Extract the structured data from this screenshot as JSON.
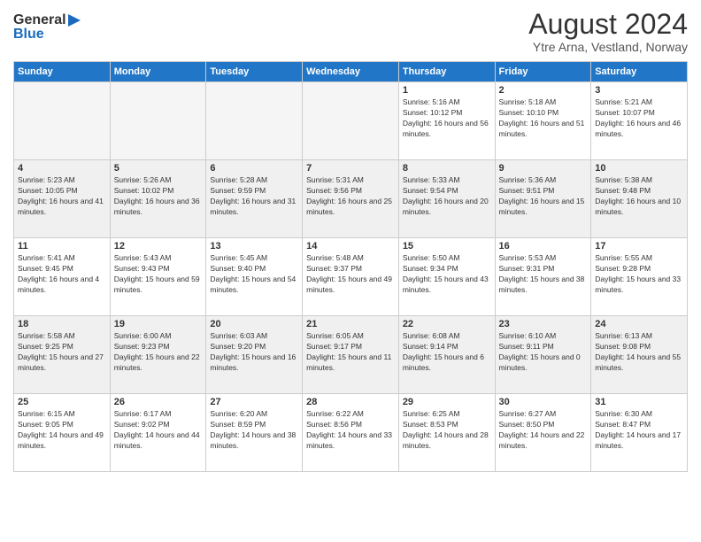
{
  "header": {
    "logo_general": "General",
    "logo_blue": "Blue",
    "month_year": "August 2024",
    "location": "Ytre Arna, Vestland, Norway"
  },
  "weekdays": [
    "Sunday",
    "Monday",
    "Tuesday",
    "Wednesday",
    "Thursday",
    "Friday",
    "Saturday"
  ],
  "weeks": [
    [
      {
        "day": "",
        "empty": true
      },
      {
        "day": "",
        "empty": true
      },
      {
        "day": "",
        "empty": true
      },
      {
        "day": "",
        "empty": true
      },
      {
        "day": "1",
        "sunrise": "5:16 AM",
        "sunset": "10:12 PM",
        "daylight": "16 hours and 56 minutes."
      },
      {
        "day": "2",
        "sunrise": "5:18 AM",
        "sunset": "10:10 PM",
        "daylight": "16 hours and 51 minutes."
      },
      {
        "day": "3",
        "sunrise": "5:21 AM",
        "sunset": "10:07 PM",
        "daylight": "16 hours and 46 minutes."
      }
    ],
    [
      {
        "day": "4",
        "sunrise": "5:23 AM",
        "sunset": "10:05 PM",
        "daylight": "16 hours and 41 minutes."
      },
      {
        "day": "5",
        "sunrise": "5:26 AM",
        "sunset": "10:02 PM",
        "daylight": "16 hours and 36 minutes."
      },
      {
        "day": "6",
        "sunrise": "5:28 AM",
        "sunset": "9:59 PM",
        "daylight": "16 hours and 31 minutes."
      },
      {
        "day": "7",
        "sunrise": "5:31 AM",
        "sunset": "9:56 PM",
        "daylight": "16 hours and 25 minutes."
      },
      {
        "day": "8",
        "sunrise": "5:33 AM",
        "sunset": "9:54 PM",
        "daylight": "16 hours and 20 minutes."
      },
      {
        "day": "9",
        "sunrise": "5:36 AM",
        "sunset": "9:51 PM",
        "daylight": "16 hours and 15 minutes."
      },
      {
        "day": "10",
        "sunrise": "5:38 AM",
        "sunset": "9:48 PM",
        "daylight": "16 hours and 10 minutes."
      }
    ],
    [
      {
        "day": "11",
        "sunrise": "5:41 AM",
        "sunset": "9:45 PM",
        "daylight": "16 hours and 4 minutes."
      },
      {
        "day": "12",
        "sunrise": "5:43 AM",
        "sunset": "9:43 PM",
        "daylight": "15 hours and 59 minutes."
      },
      {
        "day": "13",
        "sunrise": "5:45 AM",
        "sunset": "9:40 PM",
        "daylight": "15 hours and 54 minutes."
      },
      {
        "day": "14",
        "sunrise": "5:48 AM",
        "sunset": "9:37 PM",
        "daylight": "15 hours and 49 minutes."
      },
      {
        "day": "15",
        "sunrise": "5:50 AM",
        "sunset": "9:34 PM",
        "daylight": "15 hours and 43 minutes."
      },
      {
        "day": "16",
        "sunrise": "5:53 AM",
        "sunset": "9:31 PM",
        "daylight": "15 hours and 38 minutes."
      },
      {
        "day": "17",
        "sunrise": "5:55 AM",
        "sunset": "9:28 PM",
        "daylight": "15 hours and 33 minutes."
      }
    ],
    [
      {
        "day": "18",
        "sunrise": "5:58 AM",
        "sunset": "9:25 PM",
        "daylight": "15 hours and 27 minutes."
      },
      {
        "day": "19",
        "sunrise": "6:00 AM",
        "sunset": "9:23 PM",
        "daylight": "15 hours and 22 minutes."
      },
      {
        "day": "20",
        "sunrise": "6:03 AM",
        "sunset": "9:20 PM",
        "daylight": "15 hours and 16 minutes."
      },
      {
        "day": "21",
        "sunrise": "6:05 AM",
        "sunset": "9:17 PM",
        "daylight": "15 hours and 11 minutes."
      },
      {
        "day": "22",
        "sunrise": "6:08 AM",
        "sunset": "9:14 PM",
        "daylight": "15 hours and 6 minutes."
      },
      {
        "day": "23",
        "sunrise": "6:10 AM",
        "sunset": "9:11 PM",
        "daylight": "15 hours and 0 minutes."
      },
      {
        "day": "24",
        "sunrise": "6:13 AM",
        "sunset": "9:08 PM",
        "daylight": "14 hours and 55 minutes."
      }
    ],
    [
      {
        "day": "25",
        "sunrise": "6:15 AM",
        "sunset": "9:05 PM",
        "daylight": "14 hours and 49 minutes."
      },
      {
        "day": "26",
        "sunrise": "6:17 AM",
        "sunset": "9:02 PM",
        "daylight": "14 hours and 44 minutes."
      },
      {
        "day": "27",
        "sunrise": "6:20 AM",
        "sunset": "8:59 PM",
        "daylight": "14 hours and 38 minutes."
      },
      {
        "day": "28",
        "sunrise": "6:22 AM",
        "sunset": "8:56 PM",
        "daylight": "14 hours and 33 minutes."
      },
      {
        "day": "29",
        "sunrise": "6:25 AM",
        "sunset": "8:53 PM",
        "daylight": "14 hours and 28 minutes."
      },
      {
        "day": "30",
        "sunrise": "6:27 AM",
        "sunset": "8:50 PM",
        "daylight": "14 hours and 22 minutes."
      },
      {
        "day": "31",
        "sunrise": "6:30 AM",
        "sunset": "8:47 PM",
        "daylight": "14 hours and 17 minutes."
      }
    ]
  ]
}
